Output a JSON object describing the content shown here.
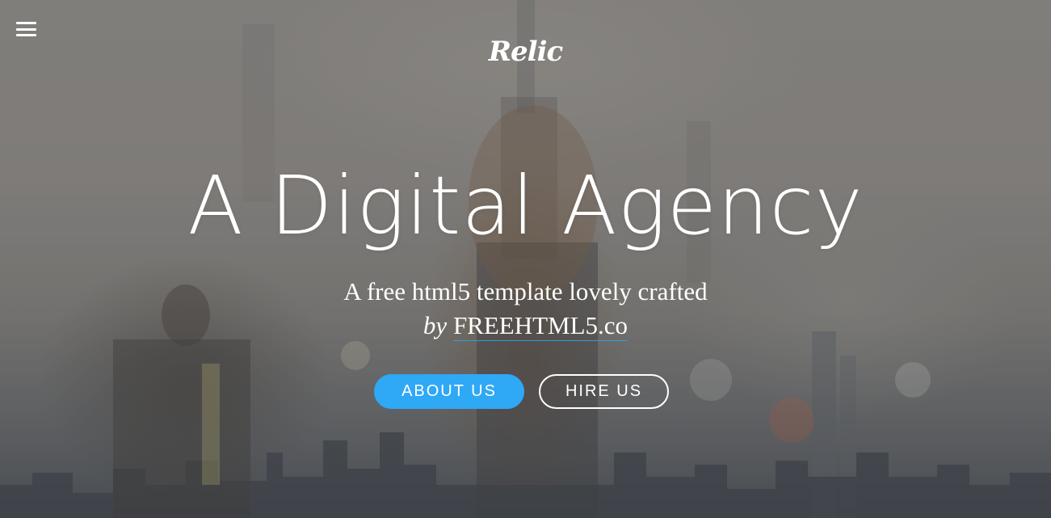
{
  "header": {
    "menu_icon": "hamburger-menu-icon",
    "logo_text": "Relic"
  },
  "hero": {
    "headline": "A Digital Agency",
    "tagline_line1": "A free html5 template lovely crafted",
    "tagline_by": "by",
    "tagline_link": "FREEHTML5.co",
    "background": "blurred city skyline with woman overlay photo"
  },
  "buttons": {
    "about_label": "ABOUT US",
    "hire_label": "HIRE US"
  },
  "colors": {
    "accent": "#2fa8f5",
    "text": "#ffffff"
  }
}
